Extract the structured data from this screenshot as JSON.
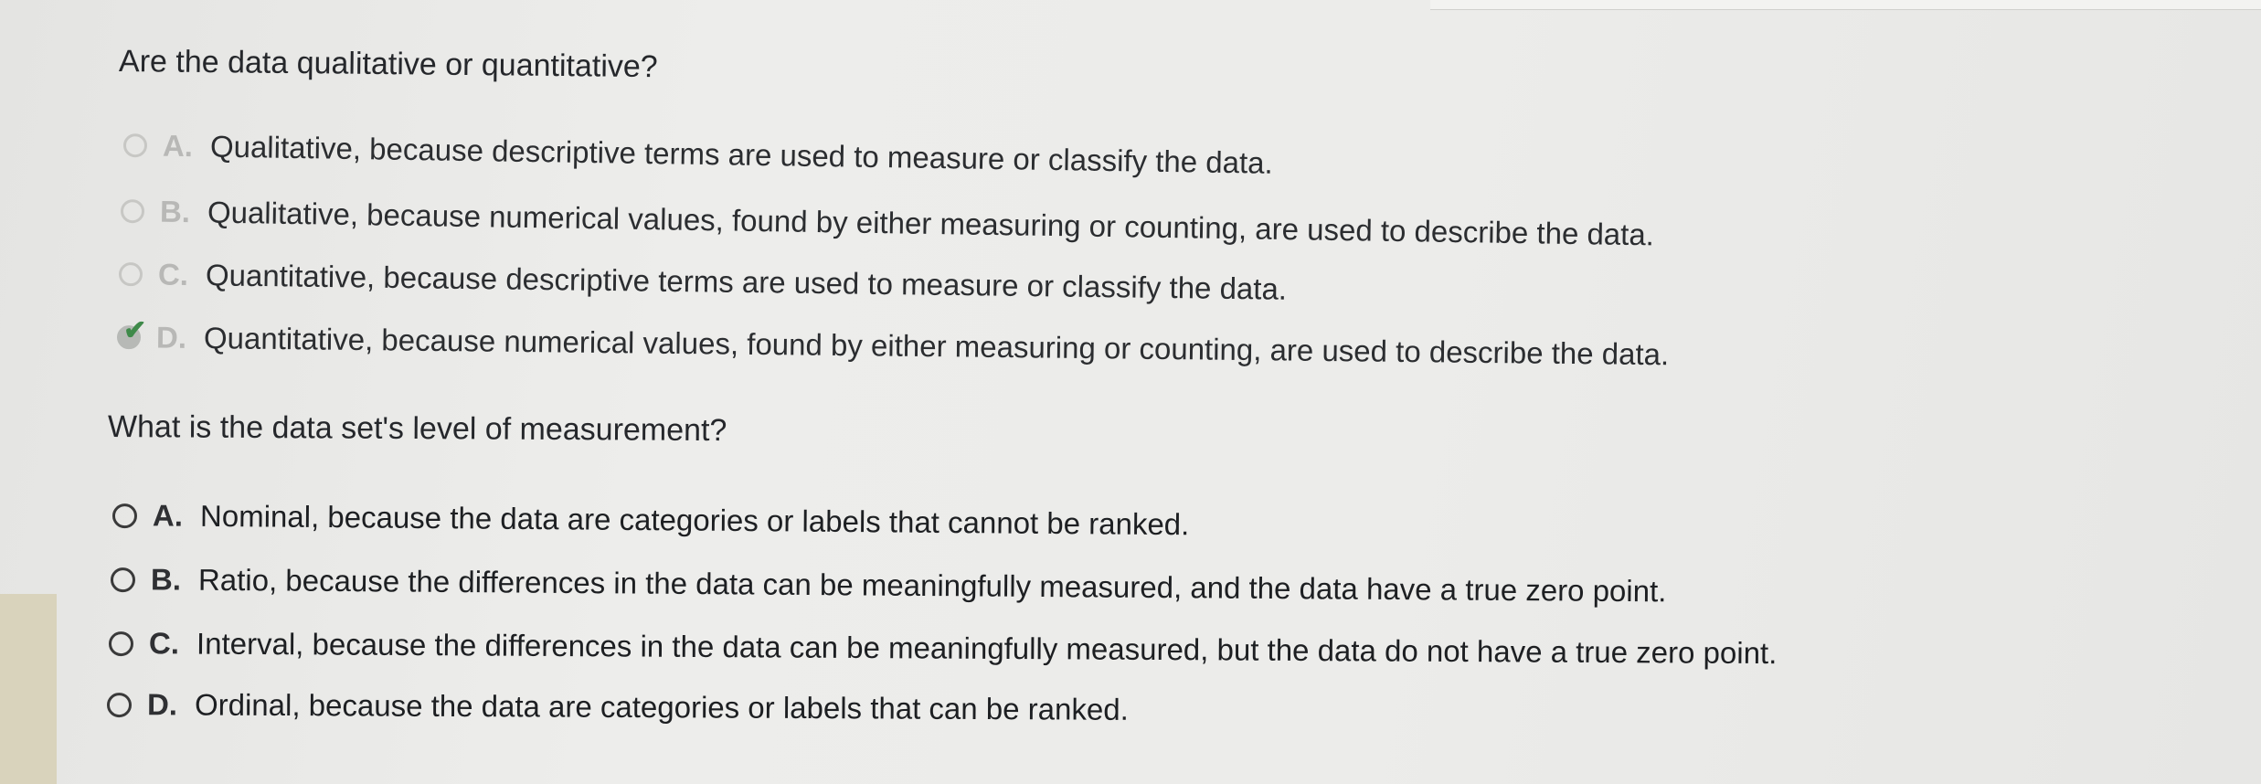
{
  "question1": {
    "text": "Are the data qualitative or quantitative?",
    "selected": "D",
    "options": [
      {
        "letter": "A.",
        "text": "Qualitative, because descriptive terms are used to measure or classify the data."
      },
      {
        "letter": "B.",
        "text": "Qualitative, because numerical values, found by either measuring or counting, are used to describe the data."
      },
      {
        "letter": "C.",
        "text": "Quantitative, because descriptive terms are used to measure or classify the data."
      },
      {
        "letter": "D.",
        "text": "Quantitative, because numerical values, found by either measuring or counting, are used to describe the data."
      }
    ]
  },
  "question2": {
    "text": "What is the data set's level of measurement?",
    "options": [
      {
        "letter": "A.",
        "text": "Nominal, because the data are categories or labels that cannot be ranked."
      },
      {
        "letter": "B.",
        "text": "Ratio, because the differences in the data can be meaningfully measured, and the data have a true zero point."
      },
      {
        "letter": "C.",
        "text": "Interval, because the differences in the data can be meaningfully measured, but the data do not have a true zero point."
      },
      {
        "letter": "D.",
        "text": "Ordinal, because the data are categories or labels that can be ranked."
      }
    ]
  },
  "icons": {
    "correct_mark": "checkmark-icon",
    "correct_mark_color": "#3f8a4a"
  }
}
